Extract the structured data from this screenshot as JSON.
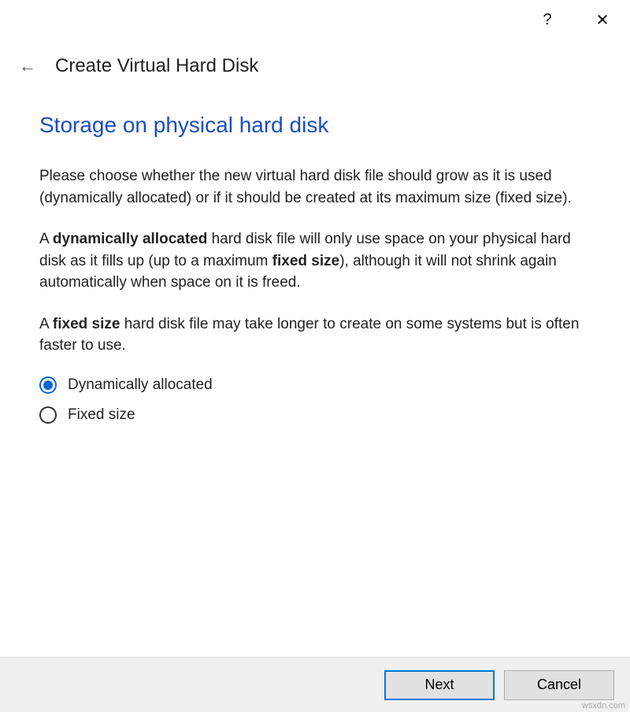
{
  "titlebar": {
    "help": "?",
    "close": "✕"
  },
  "header": {
    "back": "←",
    "title": "Create Virtual Hard Disk"
  },
  "page": {
    "heading": "Storage on physical hard disk",
    "p1": "Please choose whether the new virtual hard disk file should grow as it is used (dynamically allocated) or if it should be created at its maximum size (fixed size).",
    "p2_a": "A ",
    "p2_b": "dynamically allocated",
    "p2_c": " hard disk file will only use space on your physical hard disk as it fills up (up to a maximum ",
    "p2_d": "fixed size",
    "p2_e": "), although it will not shrink again automatically when space on it is freed.",
    "p3_a": "A ",
    "p3_b": "fixed size",
    "p3_c": " hard disk file may take longer to create on some systems but is often faster to use."
  },
  "options": {
    "opt1": "Dynamically allocated",
    "opt2": "Fixed size"
  },
  "footer": {
    "next": "Next",
    "cancel": "Cancel"
  },
  "watermark": "wsxdn.com"
}
